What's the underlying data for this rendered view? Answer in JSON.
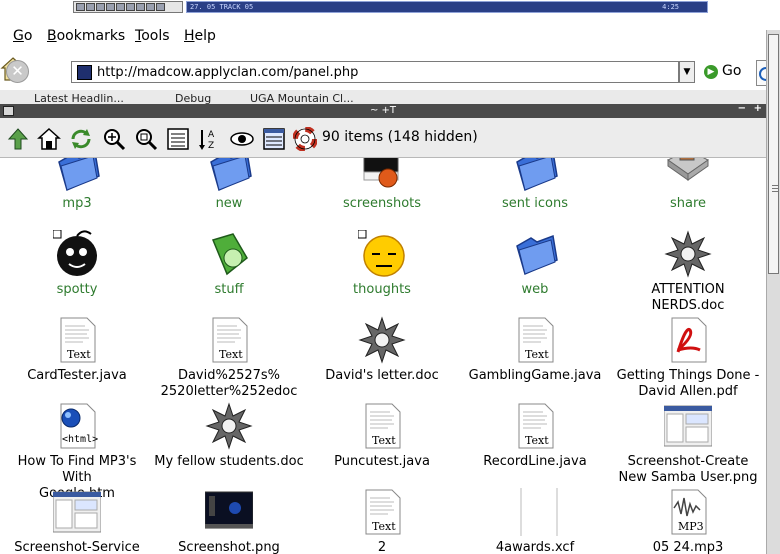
{
  "panel": {
    "track_text": "27. 05 TRACK 05",
    "time": "4:25"
  },
  "menu": [
    "Go",
    "Bookmarks",
    "Tools",
    "Help"
  ],
  "nav": {
    "url": "http://madcow.applyclan.com/panel.php",
    "go_label": "Go"
  },
  "bookmarks": [
    "Latest Headlin...",
    "Debug",
    "UGA Mountain Cl..."
  ],
  "file_manager": {
    "title": "~ +T",
    "status": "90 items (148 hidden)",
    "toolbar_icons": [
      "up-arrow-icon",
      "home-icon",
      "refresh-icon",
      "zoom-in-icon",
      "zoom-fit-icon",
      "list-view-icon",
      "sort-icon",
      "eye-icon",
      "details-view-icon",
      "lifebuoy-icon"
    ],
    "rows": [
      [
        {
          "label": "mp3",
          "icon": "folder-icon",
          "dir": true
        },
        {
          "label": "new",
          "icon": "folder-icon",
          "dir": true
        },
        {
          "label": "screenshots",
          "icon": "monitor-icon",
          "dir": true
        },
        {
          "label": "sent icons",
          "icon": "folder-icon",
          "dir": true
        },
        {
          "label": "share",
          "icon": "share-drive-icon",
          "dir": true
        }
      ],
      [
        {
          "label": "spotty",
          "icon": "bomb-icon",
          "dir": true
        },
        {
          "label": "stuff",
          "icon": "green-folder-icon",
          "dir": true
        },
        {
          "label": "thoughts",
          "icon": "smiley-icon",
          "dir": true
        },
        {
          "label": "web",
          "icon": "folder-icon",
          "dir": true
        },
        {
          "label": "ATTENTION NERDS.doc",
          "icon": "gear-document-icon",
          "dir": false
        }
      ],
      [
        {
          "label": "CardTester.java",
          "icon": "text-file-icon",
          "dir": false
        },
        {
          "label": "David%2527s%\n2520letter%252edoc",
          "icon": "text-file-icon",
          "dir": false
        },
        {
          "label": "David's letter.doc",
          "icon": "gear-document-icon",
          "dir": false
        },
        {
          "label": "GamblingGame.java",
          "icon": "text-file-icon",
          "dir": false
        },
        {
          "label": "Getting Things Done -\nDavid Allen.pdf",
          "icon": "pdf-icon",
          "dir": false
        }
      ],
      [
        {
          "label": "How To Find MP3's With\nGoogle.htm",
          "icon": "html-file-icon",
          "dir": false
        },
        {
          "label": "My fellow students.doc",
          "icon": "gear-document-icon",
          "dir": false
        },
        {
          "label": "Puncutest.java",
          "icon": "text-file-icon",
          "dir": false
        },
        {
          "label": "RecordLine.java",
          "icon": "text-file-icon",
          "dir": false
        },
        {
          "label": "Screenshot-Create\nNew Samba User.png",
          "icon": "image-thumbnail-icon",
          "dir": false
        }
      ],
      [
        {
          "label": "Screenshot-Service",
          "icon": "image-thumbnail-icon",
          "dir": false
        },
        {
          "label": "Screenshot.png",
          "icon": "dark-screenshot-icon",
          "dir": false
        },
        {
          "label": "2",
          "icon": "text-file-icon",
          "dir": false
        },
        {
          "label": "4awards.xcf",
          "icon": "blank-file-icon",
          "dir": false
        },
        {
          "label": "05 24.mp3",
          "icon": "mp3-file-icon",
          "dir": false
        }
      ]
    ]
  }
}
